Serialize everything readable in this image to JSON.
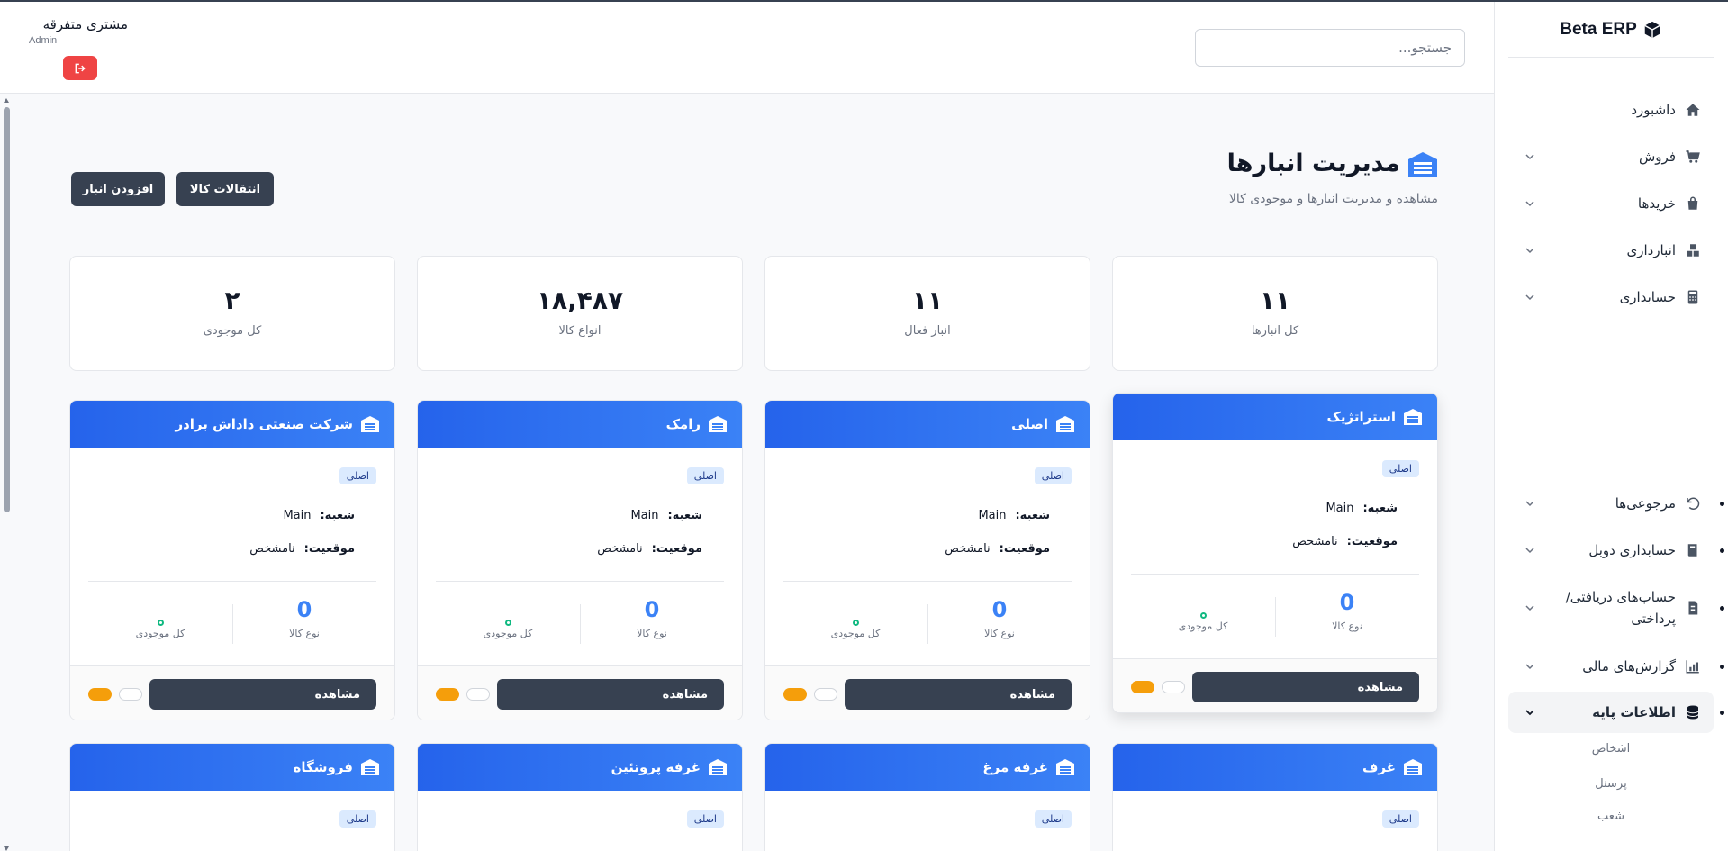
{
  "brand": {
    "name": "Beta ERP"
  },
  "sidebar": {
    "items": [
      {
        "label": "داشبورد",
        "icon": "home-icon",
        "chevron": false
      },
      {
        "label": "فروش",
        "icon": "cart-icon",
        "chevron": true
      },
      {
        "label": "خریدها",
        "icon": "bag-icon",
        "chevron": true
      },
      {
        "label": "انبارداری",
        "icon": "boxes-icon",
        "chevron": true
      },
      {
        "label": "حسابداری",
        "icon": "calculator-icon",
        "chevron": true
      },
      {
        "label": "مرجوعی‌ها",
        "icon": "undo-icon",
        "chevron": true
      },
      {
        "label": "حسابداری دوبل",
        "icon": "book-icon",
        "chevron": true
      },
      {
        "label": "حساب‌های دریافتی/",
        "label2": "پرداختی",
        "icon": "invoice-icon",
        "chevron": true
      },
      {
        "label": "گزارش‌های مالی",
        "icon": "chart-icon",
        "chevron": true
      },
      {
        "label": "اطلاعات پایه",
        "icon": "database-icon",
        "chevron": true,
        "active": true
      }
    ],
    "subitems": [
      "اشخاص",
      "پرسنل",
      "شعب"
    ]
  },
  "header": {
    "search_placeholder": "جستجو...",
    "user_name": "مشتری متفرقه",
    "user_role": "Admin"
  },
  "page": {
    "title": "مدیریت انبارها",
    "subtitle": "مشاهده و مدیریت انبارها و موجودی کالا",
    "add_button": "افزودن انبار",
    "transfer_button": "انتقالات کالا"
  },
  "stats": [
    {
      "value": "۱۱",
      "label": "کل انبارها"
    },
    {
      "value": "۱۱",
      "label": "انبار فعال"
    },
    {
      "value": "۱۸,۴۸۷",
      "label": "انواع کالا"
    },
    {
      "value": "۲",
      "label": "کل موجودی"
    }
  ],
  "warehouses": [
    {
      "name": "استراتژیک",
      "badge": "اصلی",
      "branch_label": "شعبه:",
      "branch": "Main",
      "location_label": "موقعیت:",
      "location": "نامشخص",
      "item_types": "0",
      "item_types_label": "نوع کالا",
      "total_label": "کل موجودی",
      "view_label": "مشاهده"
    },
    {
      "name": "اصلی",
      "badge": "اصلی",
      "branch_label": "شعبه:",
      "branch": "Main",
      "location_label": "موقعیت:",
      "location": "نامشخص",
      "item_types": "0",
      "item_types_label": "نوع کالا",
      "total_label": "کل موجودی",
      "view_label": "مشاهده"
    },
    {
      "name": "رامک",
      "badge": "اصلی",
      "branch_label": "شعبه:",
      "branch": "Main",
      "location_label": "موقعیت:",
      "location": "نامشخص",
      "item_types": "0",
      "item_types_label": "نوع کالا",
      "total_label": "کل موجودی",
      "view_label": "مشاهده"
    },
    {
      "name": "شرکت صنعتی داداش برادر",
      "badge": "اصلی",
      "branch_label": "شعبه:",
      "branch": "Main",
      "location_label": "موقعیت:",
      "location": "نامشخص",
      "item_types": "0",
      "item_types_label": "نوع کالا",
      "total_label": "کل موجودی",
      "view_label": "مشاهده"
    },
    {
      "name": "غرف",
      "badge": "اصلی"
    },
    {
      "name": "غرفه مرغ",
      "badge": "اصلی"
    },
    {
      "name": "غرفه پروتئین",
      "badge": "اصلی"
    },
    {
      "name": "فروشگاه",
      "badge": "اصلی"
    }
  ],
  "colors": {
    "accent": "#3b82f6",
    "dark_button": "#374151",
    "danger": "#ef4444",
    "warning": "#f59e0b",
    "success": "#10b981"
  }
}
